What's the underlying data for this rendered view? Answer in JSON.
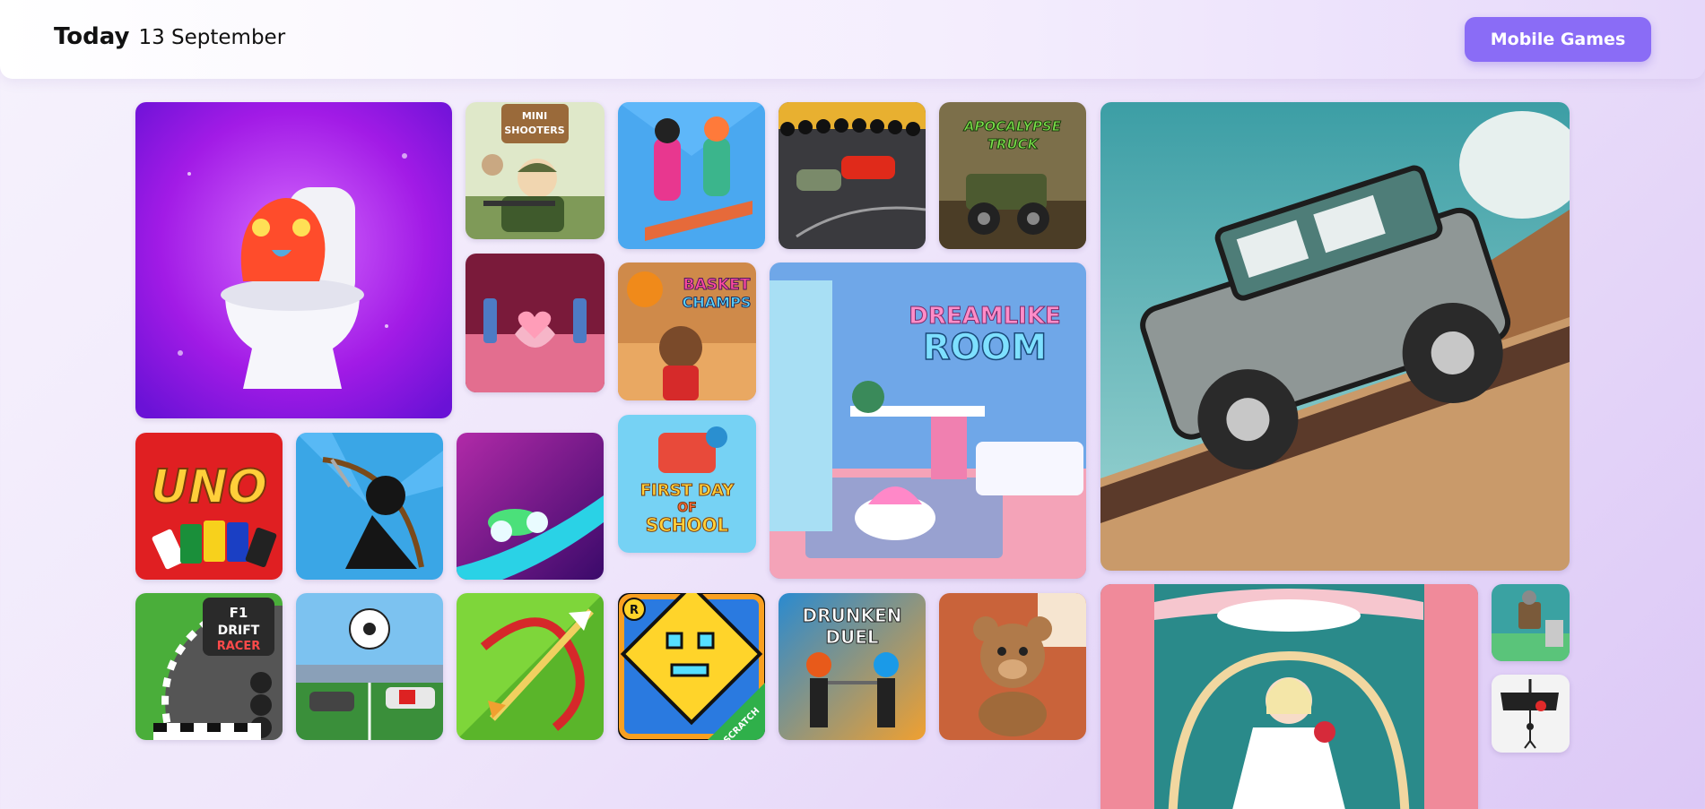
{
  "header": {
    "today_label": "Today",
    "date": "13 September",
    "mobile_button": "Mobile Games"
  },
  "tiles": {
    "mini_shooters": {
      "line1": "MINI",
      "line2": "SHOOTERS"
    },
    "apocalypse_truck": {
      "line1": "APOCALYPSE",
      "line2": "TRUCK"
    },
    "basket_champs": {
      "line1": "BASKET",
      "line2": "CHAMPS"
    },
    "dreamlike_room": {
      "line1": "DREAMLIKE",
      "line2": "ROOM"
    },
    "first_day_school": {
      "line1": "FIRST DAY",
      "line2": "OF",
      "line3": "SCHOOL"
    },
    "uno": {
      "title": "UNO"
    },
    "f1_drift": {
      "line1": "F1",
      "line2": "DRIFT",
      "line3": "RACER"
    },
    "geometry_dash": {
      "badge": "R",
      "ribbon": "SCRATCH"
    },
    "drunken_duel": {
      "line1": "DRUNKEN",
      "line2": "DUEL"
    }
  },
  "colors": {
    "accent": "#8a6cf6"
  }
}
